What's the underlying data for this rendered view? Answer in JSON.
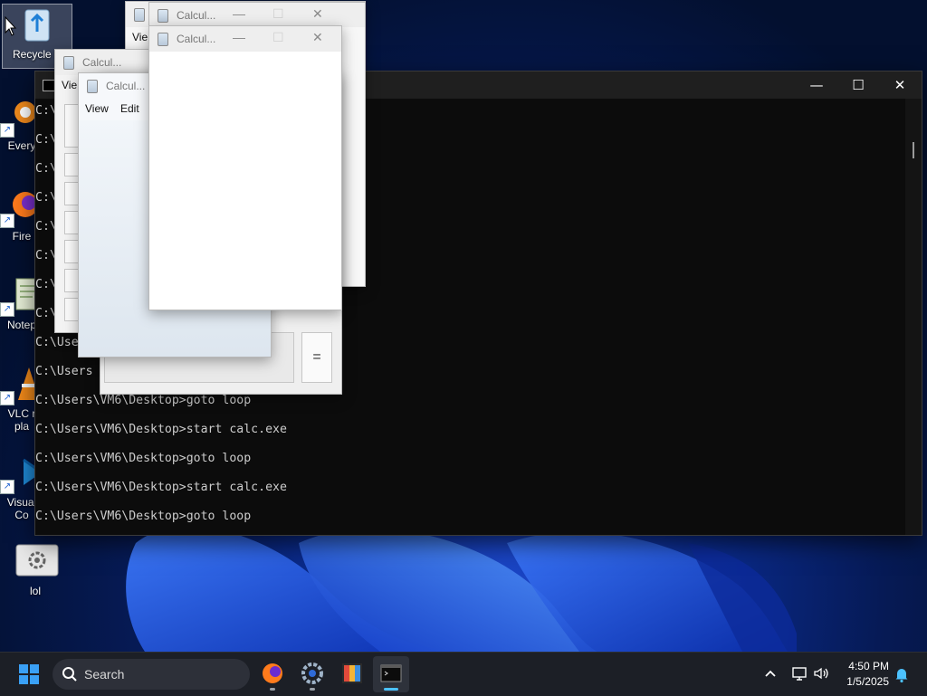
{
  "desktop": {
    "icons": [
      {
        "label": "Recycle B",
        "icon": "recycle-bin-icon"
      },
      {
        "label": "Every",
        "icon": "everything-search-icon"
      },
      {
        "label": "Fire",
        "icon": "firefox-icon"
      },
      {
        "label": "Notep",
        "icon": "notepad-icon"
      },
      {
        "label_line1": "VLC r",
        "label_line2": "pla",
        "icon": "vlc-icon"
      },
      {
        "label_line1": "Visual",
        "label_line2": "Co",
        "icon": "vscode-icon"
      },
      {
        "label": "lol",
        "icon": "settings-shortcut-icon"
      }
    ]
  },
  "terminal": {
    "title_icon": "cmd-icon",
    "controls": {
      "minimize": "—",
      "maximize": "☐",
      "close": "✕"
    },
    "lines": [
      "C:\\",
      "C:\\",
      "C:\\",
      "C:\\",
      "C:\\",
      "C:\\",
      "C:\\",
      "C:\\",
      "C:\\Use",
      "C:\\Users",
      "C:\\Users\\VM6\\Desktop>goto loop",
      "C:\\Users\\VM6\\Desktop>start calc.exe",
      "C:\\Users\\VM6\\Desktop>goto loop",
      "C:\\Users\\VM6\\Desktop>start calc.exe",
      "C:\\Users\\VM6\\Desktop>goto loop"
    ]
  },
  "calculators": [
    {
      "title": "Calcul...",
      "menu_view": "Vie"
    },
    {
      "title": "Calcul...",
      "menu_view": "Vie"
    },
    {
      "title": "Calcul...",
      "menu_view": "Vie"
    },
    {
      "title": "Calcul...",
      "menu_view": "View",
      "menu_edit": "Edit"
    },
    {
      "title": "Calcul..."
    },
    {
      "title": "Calcul..."
    }
  ],
  "calc_buttons": {
    "equals": "="
  },
  "taskbar": {
    "start_icon": "windows-start-icon",
    "search_placeholder": "Search",
    "apps": [
      "firefox-icon",
      "settings-icon",
      "photos-icon",
      "terminal-icon"
    ],
    "tray": {
      "time": "4:50 PM",
      "date": "1/5/2025"
    }
  },
  "colors": {
    "taskbar_bg": "#1c1f26",
    "terminal_bg": "#0c0c0c",
    "active_indicator": "#4cc2ff"
  }
}
